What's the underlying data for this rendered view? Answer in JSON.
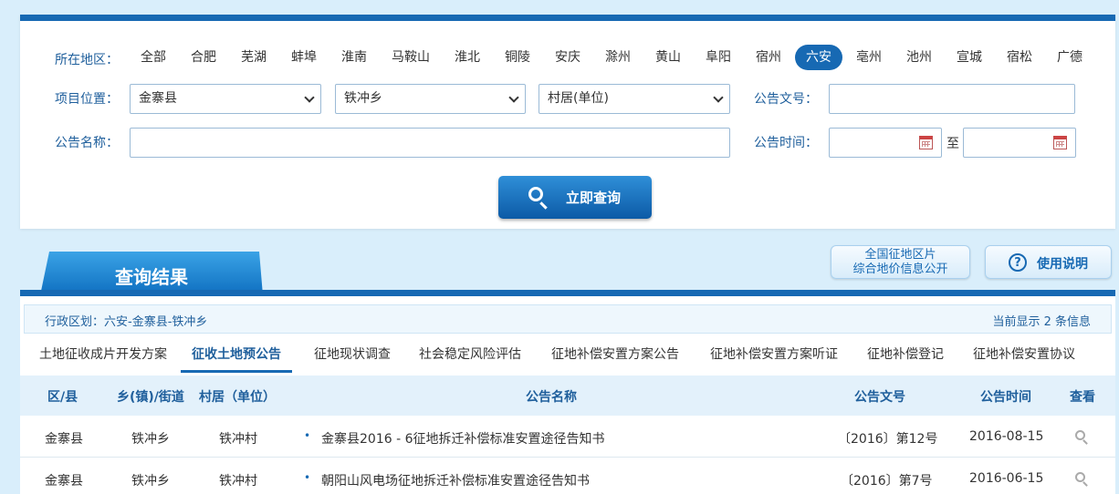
{
  "search": {
    "region_label": "所在地区：",
    "regions": [
      "全部",
      "合肥",
      "芜湖",
      "蚌埠",
      "淮南",
      "马鞍山",
      "淮北",
      "铜陵",
      "安庆",
      "滁州",
      "黄山",
      "阜阳",
      "宿州",
      "六安",
      "亳州",
      "池州",
      "宣城",
      "宿松",
      "广德"
    ],
    "active_region": "六安",
    "location_label": "项目位置：",
    "county_value": "金寨县",
    "town_value": "铁冲乡",
    "village_value": "村居(单位)",
    "doc_no_label": "公告文号：",
    "doc_no_value": "",
    "name_label": "公告名称：",
    "name_value": "",
    "time_label": "公告时间：",
    "date_from": "",
    "date_to": "",
    "to_label": "至",
    "submit_label": "立即查询"
  },
  "results": {
    "tab_title": "查询结果",
    "land_button_line1": "全国征地区片",
    "land_button_line2": "综合地价信息公开",
    "help_button": "使用说明",
    "region_path": "行政区划：六安-金寨县-铁冲乡",
    "count_text": "当前显示 2 条信息",
    "tabs": [
      "土地征收成片开发方案",
      "征收土地预公告",
      "征地现状调查",
      "社会稳定风险评估",
      "征地补偿安置方案公告",
      "征地补偿安置方案听证",
      "征地补偿登记",
      "征地补偿安置协议"
    ],
    "active_tab": "征收土地预公告",
    "columns": {
      "county": "区/县",
      "town": "乡(镇)/街道",
      "village": "村居（单位）",
      "title": "公告名称",
      "doc_no": "公告文号",
      "date": "公告时间",
      "view": "查看"
    },
    "rows": [
      {
        "county": "金寨县",
        "town": "铁冲乡",
        "village": "铁冲村",
        "title": "金寨县2016 - 6征地拆迁补偿标准安置途径告知书",
        "doc_no": "〔2016〕第12号",
        "date": "2016-08-15"
      },
      {
        "county": "金寨县",
        "town": "铁冲乡",
        "village": "铁冲村",
        "title": "朝阳山风电场征地拆迁补偿标准安置途径告知书",
        "doc_no": "〔2016〕第7号",
        "date": "2016-06-15"
      }
    ]
  }
}
